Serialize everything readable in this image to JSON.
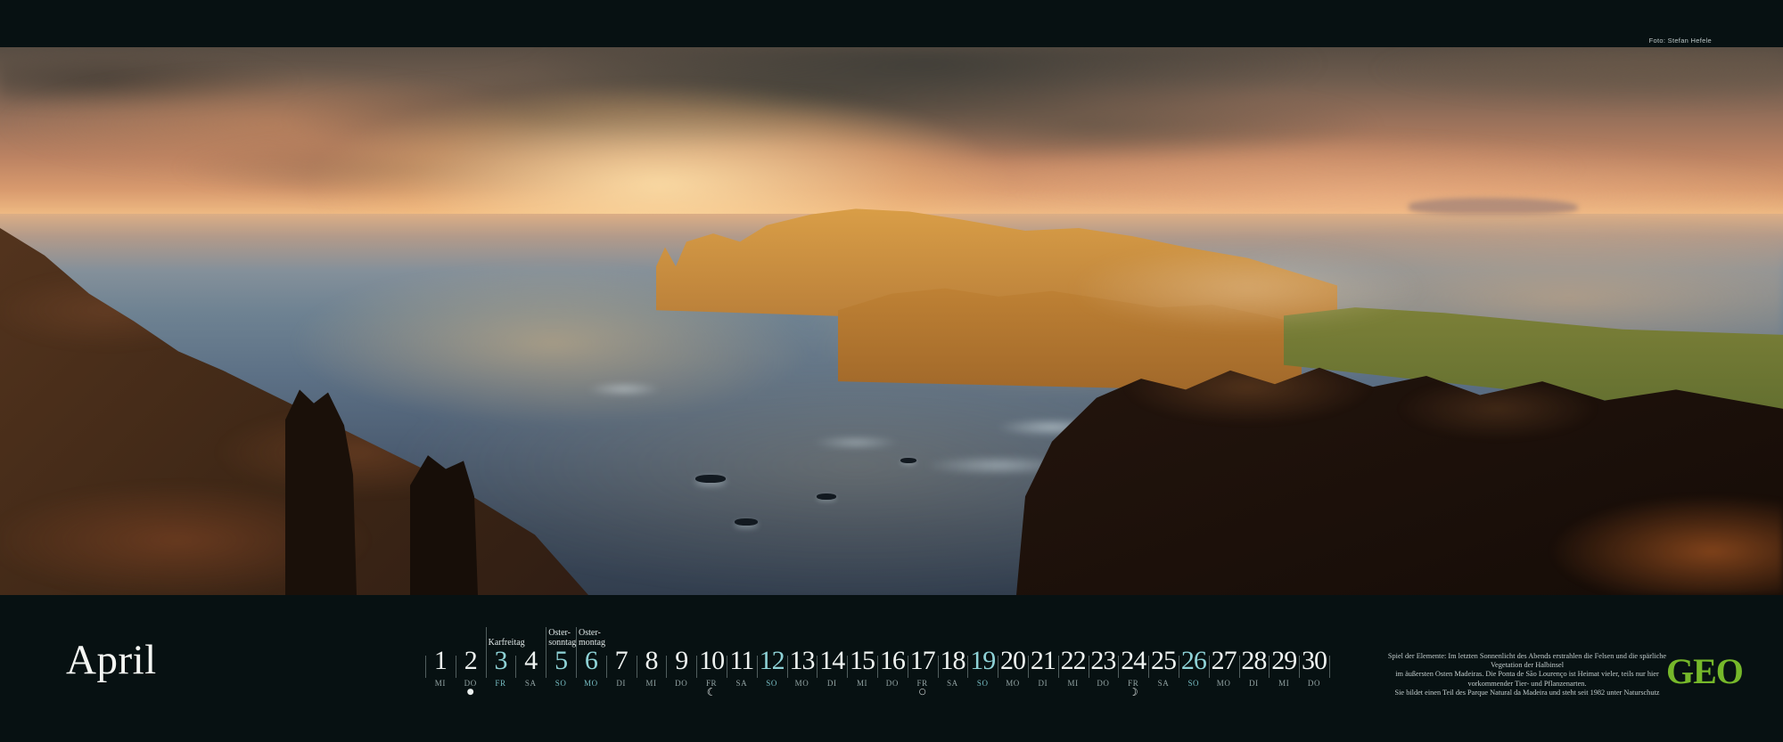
{
  "page": {
    "month_title": "April",
    "photo_credit": "Foto: Stefan Hefele",
    "photo_subject": "panoramic-sunset-cliffs-ponta-de-sao-lourenco-madeira"
  },
  "colors": {
    "background": "#071112",
    "accent_teal": "#8ed2d6",
    "geo_green": "#76b82a",
    "day_white": "#eef2f0"
  },
  "logo": {
    "text": "GEO"
  },
  "caption": {
    "lines": [
      "Spiel der Elemente: Im letzten Sonnenlicht des Abends erstrahlen die Felsen und die spärliche Vegetation der Halbinsel",
      "im äußersten Osten Madeiras. Die Ponta de São Lourenço ist Heimat vieler, teils nur hier vorkommender Tier- und Pflanzenarten.",
      "Sie bildet einen Teil des Parque Natural da Madeira und steht seit 1982 unter Naturschutz"
    ]
  },
  "calendar": {
    "moon_glyphs": {
      "full-moon-icon": "●",
      "last-quarter-moon-icon": "☾",
      "new-moon-icon": "○",
      "first-quarter-moon-icon": "☽"
    },
    "days": [
      {
        "num": "1",
        "wd": "MI"
      },
      {
        "num": "2",
        "wd": "DO",
        "moon": "full-moon-icon"
      },
      {
        "num": "3",
        "wd": "FR",
        "holiday": true,
        "label": [
          "Karfreitag"
        ]
      },
      {
        "num": "4",
        "wd": "SA"
      },
      {
        "num": "5",
        "wd": "SO",
        "holiday": true,
        "label": [
          "Oster-",
          "sonntag"
        ]
      },
      {
        "num": "6",
        "wd": "MO",
        "holiday": true,
        "label": [
          "Oster-",
          "montag"
        ]
      },
      {
        "num": "7",
        "wd": "DI"
      },
      {
        "num": "8",
        "wd": "MI"
      },
      {
        "num": "9",
        "wd": "DO"
      },
      {
        "num": "10",
        "wd": "FR",
        "moon": "last-quarter-moon-icon"
      },
      {
        "num": "11",
        "wd": "SA"
      },
      {
        "num": "12",
        "wd": "SO",
        "holiday": true
      },
      {
        "num": "13",
        "wd": "MO"
      },
      {
        "num": "14",
        "wd": "DI"
      },
      {
        "num": "15",
        "wd": "MI"
      },
      {
        "num": "16",
        "wd": "DO"
      },
      {
        "num": "17",
        "wd": "FR",
        "moon": "new-moon-icon"
      },
      {
        "num": "18",
        "wd": "SA"
      },
      {
        "num": "19",
        "wd": "SO",
        "holiday": true
      },
      {
        "num": "20",
        "wd": "MO"
      },
      {
        "num": "21",
        "wd": "DI"
      },
      {
        "num": "22",
        "wd": "MI"
      },
      {
        "num": "23",
        "wd": "DO"
      },
      {
        "num": "24",
        "wd": "FR",
        "moon": "first-quarter-moon-icon"
      },
      {
        "num": "25",
        "wd": "SA"
      },
      {
        "num": "26",
        "wd": "SO",
        "holiday": true
      },
      {
        "num": "27",
        "wd": "MO"
      },
      {
        "num": "28",
        "wd": "DI"
      },
      {
        "num": "29",
        "wd": "MI"
      },
      {
        "num": "30",
        "wd": "DO"
      }
    ]
  }
}
